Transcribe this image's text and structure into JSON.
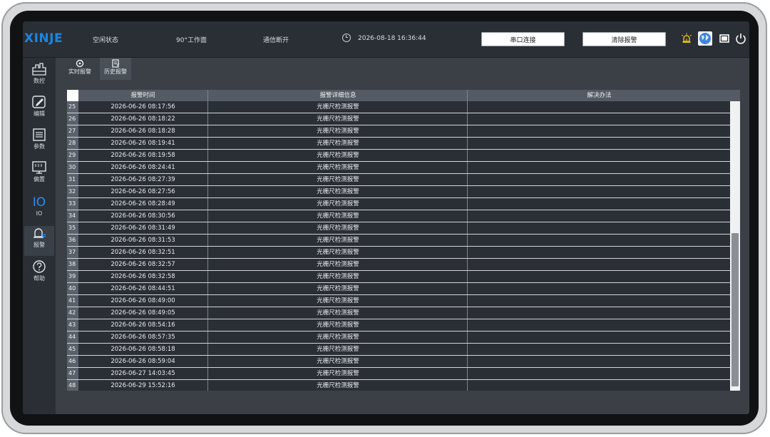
{
  "topbar": {
    "logo": "XINJE",
    "status": "空闲状态",
    "mode": "90°工作面",
    "comm": "通信断开",
    "datetime": "2026-08-18 16:36:44",
    "serial_button": "串口连接",
    "clear_button": "清除报警"
  },
  "sidebar": {
    "items": [
      {
        "label": "数控",
        "icon": "cnc-icon"
      },
      {
        "label": "编辑",
        "icon": "edit-icon"
      },
      {
        "label": "参数",
        "icon": "params-icon"
      },
      {
        "label": "偏置",
        "icon": "offset-icon"
      },
      {
        "label": "IO",
        "icon": "io-icon"
      },
      {
        "label": "报警",
        "icon": "alarm-icon"
      },
      {
        "label": "帮助",
        "icon": "help-icon"
      }
    ],
    "active": "报警",
    "io_glyph": "IO"
  },
  "tabs": [
    {
      "label": "实时报警"
    },
    {
      "label": "历史报警"
    }
  ],
  "table": {
    "headers": [
      "报警时间",
      "报警详细信息",
      "解决办法"
    ],
    "rows": [
      {
        "idx": "25",
        "time": "2026-06-26 08:17:56",
        "info": "光栅尺检测报警",
        "solution": ""
      },
      {
        "idx": "26",
        "time": "2026-06-26 08:18:22",
        "info": "光栅尺检测报警",
        "solution": ""
      },
      {
        "idx": "27",
        "time": "2026-06-26 08:18:28",
        "info": "光栅尺检测报警",
        "solution": ""
      },
      {
        "idx": "28",
        "time": "2026-06-26 08:19:41",
        "info": "光栅尺检测报警",
        "solution": ""
      },
      {
        "idx": "29",
        "time": "2026-06-26 08:19:58",
        "info": "光栅尺检测报警",
        "solution": ""
      },
      {
        "idx": "30",
        "time": "2026-06-26 08:24:41",
        "info": "光栅尺检测报警",
        "solution": ""
      },
      {
        "idx": "31",
        "time": "2026-06-26 08:27:39",
        "info": "光栅尺检测报警",
        "solution": ""
      },
      {
        "idx": "32",
        "time": "2026-06-26 08:27:56",
        "info": "光栅尺检测报警",
        "solution": ""
      },
      {
        "idx": "33",
        "time": "2026-06-26 08:28:49",
        "info": "光栅尺检测报警",
        "solution": ""
      },
      {
        "idx": "34",
        "time": "2026-06-26 08:30:56",
        "info": "光栅尺检测报警",
        "solution": ""
      },
      {
        "idx": "35",
        "time": "2026-06-26 08:31:49",
        "info": "光栅尺检测报警",
        "solution": ""
      },
      {
        "idx": "36",
        "time": "2026-06-26 08:31:53",
        "info": "光栅尺检测报警",
        "solution": ""
      },
      {
        "idx": "37",
        "time": "2026-06-26 08:32:51",
        "info": "光栅尺检测报警",
        "solution": ""
      },
      {
        "idx": "38",
        "time": "2026-06-26 08:32:57",
        "info": "光栅尺检测报警",
        "solution": ""
      },
      {
        "idx": "39",
        "time": "2026-06-26 08:32:58",
        "info": "光栅尺检测报警",
        "solution": ""
      },
      {
        "idx": "40",
        "time": "2026-06-26 08:44:51",
        "info": "光栅尺检测报警",
        "solution": ""
      },
      {
        "idx": "41",
        "time": "2026-06-26 08:49:00",
        "info": "光栅尺检测报警",
        "solution": ""
      },
      {
        "idx": "42",
        "time": "2026-06-26 08:49:05",
        "info": "光栅尺检测报警",
        "solution": ""
      },
      {
        "idx": "43",
        "time": "2026-06-26 08:54:16",
        "info": "光栅尺检测报警",
        "solution": ""
      },
      {
        "idx": "44",
        "time": "2026-06-26 08:57:35",
        "info": "光栅尺检测报警",
        "solution": ""
      },
      {
        "idx": "45",
        "time": "2026-06-26 08:58:18",
        "info": "光栅尺检测报警",
        "solution": ""
      },
      {
        "idx": "46",
        "time": "2026-06-26 08:59:04",
        "info": "光栅尺检测报警",
        "solution": ""
      },
      {
        "idx": "47",
        "time": "2026-06-27 14:03:45",
        "info": "光栅尺检测报警",
        "solution": ""
      },
      {
        "idx": "48",
        "time": "2026-06-29 15:52:16",
        "info": "光栅尺检测报警",
        "solution": ""
      }
    ]
  },
  "colors": {
    "accent": "#1b86e0",
    "alarm_light": "#e8c21a",
    "background": "#2c3138"
  }
}
